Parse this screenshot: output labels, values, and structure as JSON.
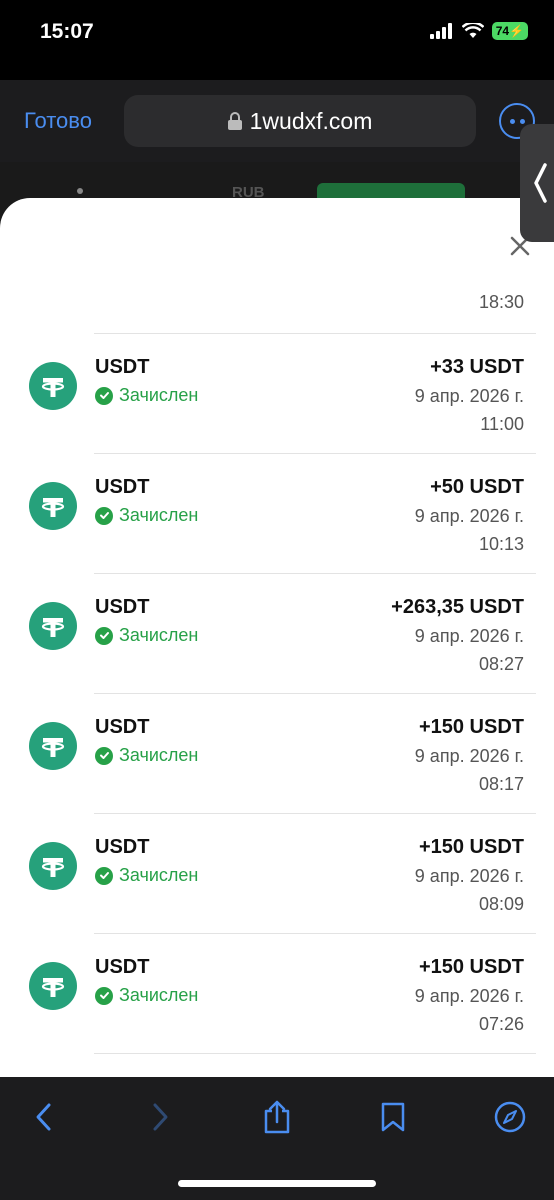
{
  "status_bar": {
    "time": "15:07",
    "battery": "74"
  },
  "browser": {
    "done_label": "Готово",
    "url": "1wudxf.com"
  },
  "behind": {
    "currency": "RUB"
  },
  "sheet": {
    "top_time": "18:30",
    "transactions": [
      {
        "name": "USDT",
        "status": "Зачислен",
        "amount": "+33 USDT",
        "date": "9 апр. 2026 г.",
        "time": "11:00"
      },
      {
        "name": "USDT",
        "status": "Зачислен",
        "amount": "+50 USDT",
        "date": "9 апр. 2026 г.",
        "time": "10:13"
      },
      {
        "name": "USDT",
        "status": "Зачислен",
        "amount": "+263,35 USDT",
        "date": "9 апр. 2026 г.",
        "time": "08:27"
      },
      {
        "name": "USDT",
        "status": "Зачислен",
        "amount": "+150 USDT",
        "date": "9 апр. 2026 г.",
        "time": "08:17"
      },
      {
        "name": "USDT",
        "status": "Зачислен",
        "amount": "+150 USDT",
        "date": "9 апр. 2026 г.",
        "time": "08:09"
      },
      {
        "name": "USDT",
        "status": "Зачислен",
        "amount": "+150 USDT",
        "date": "9 апр. 2026 г.",
        "time": "07:26"
      }
    ]
  },
  "toolbar": {
    "icons": [
      "back-icon",
      "forward-icon",
      "share-icon",
      "bookmarks-icon",
      "compass-icon"
    ]
  },
  "colors": {
    "accent": "#4a8df0",
    "success": "#27a148",
    "tether": "#26a17b"
  }
}
